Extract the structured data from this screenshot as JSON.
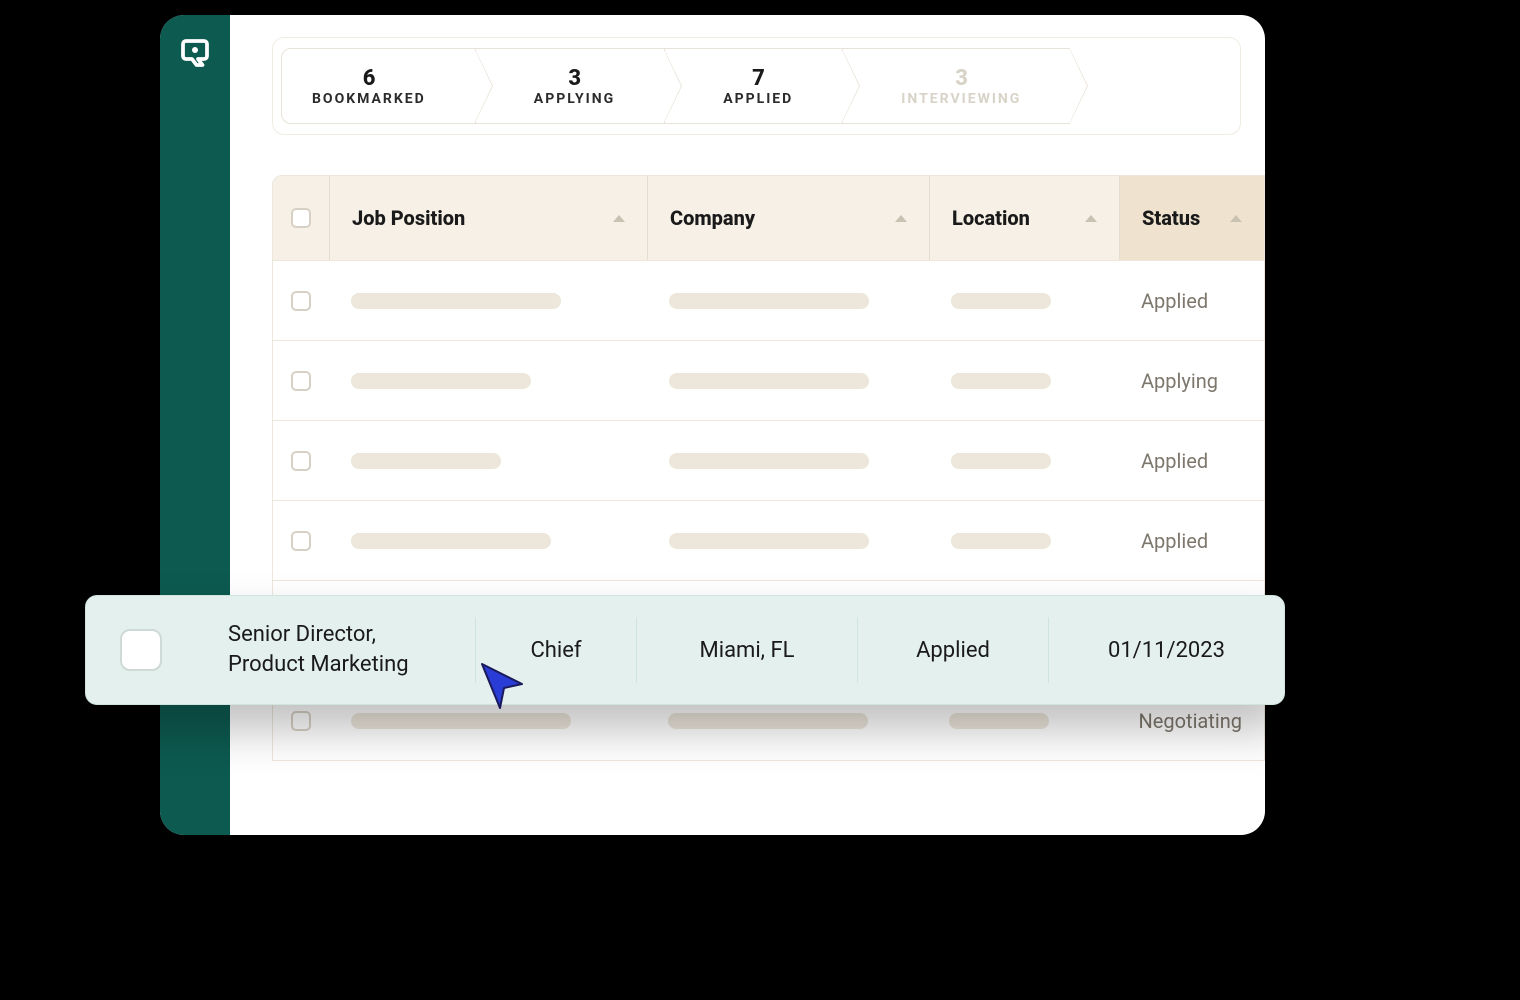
{
  "pipeline": [
    {
      "count": "6",
      "label": "BOOKMARKED"
    },
    {
      "count": "3",
      "label": "APPLYING"
    },
    {
      "count": "7",
      "label": "APPLIED"
    },
    {
      "count": "3",
      "label": "INTERVIEWING"
    }
  ],
  "columns": {
    "position": "Job Position",
    "company": "Company",
    "location": "Location",
    "status": "Status"
  },
  "rows": [
    {
      "status": "Applied"
    },
    {
      "status": "Applying"
    },
    {
      "status": "Applied"
    },
    {
      "status": "Applied"
    },
    {
      "status": ""
    },
    {
      "status": "Negotiating"
    }
  ],
  "focus": {
    "position_line1": "Senior Director,",
    "position_line2": "Product Marketing",
    "company": "Chief",
    "location": "Miami, FL",
    "status": "Applied",
    "date": "01/11/2023"
  }
}
